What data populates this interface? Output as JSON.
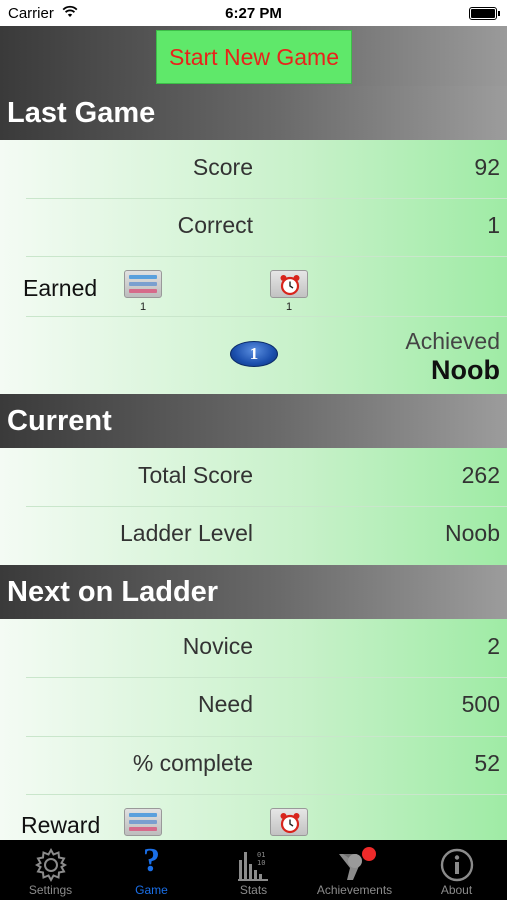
{
  "status_bar": {
    "carrier": "Carrier",
    "time": "6:27 PM"
  },
  "top": {
    "start_button": "Start New Game"
  },
  "last_game": {
    "header": "Last Game",
    "rows": [
      {
        "label": "Score",
        "value": "92"
      },
      {
        "label": "Correct",
        "value": "1"
      }
    ],
    "earned_label": "Earned",
    "earned_items": [
      {
        "icon": "choice-icon",
        "count": "1"
      },
      {
        "icon": "alarm-clock-icon",
        "count": "1"
      }
    ],
    "level_badge": "1",
    "achieved_label": "Achieved",
    "achieved_value": "Noob"
  },
  "current": {
    "header": "Current",
    "rows": [
      {
        "label": "Total Score",
        "value": "262"
      },
      {
        "label": "Ladder Level",
        "value": "Noob"
      }
    ]
  },
  "next": {
    "header": "Next on Ladder",
    "rows": [
      {
        "label": "Novice",
        "value": "2"
      },
      {
        "label": "Need",
        "value": "500"
      },
      {
        "label": "% complete",
        "value": "52"
      }
    ],
    "reward_label": "Reward",
    "reward_items": [
      {
        "icon": "choice-icon"
      },
      {
        "icon": "alarm-clock-icon"
      }
    ]
  },
  "tabs": [
    {
      "label": "Settings",
      "icon": "gear-icon",
      "active": false
    },
    {
      "label": "Game",
      "icon": "question-icon",
      "active": true
    },
    {
      "label": "Stats",
      "icon": "stats-icon",
      "active": false
    },
    {
      "label": "Achievements",
      "icon": "medal-icon",
      "active": false
    },
    {
      "label": "About",
      "icon": "info-icon",
      "active": false
    }
  ],
  "colors": {
    "start_button_bg": "#5fe86a",
    "start_button_text": "#e8231b",
    "active_tab": "#1a6fe8",
    "inactive_tab": "#8b8b8b",
    "notification_dot": "#ee2a2a"
  }
}
